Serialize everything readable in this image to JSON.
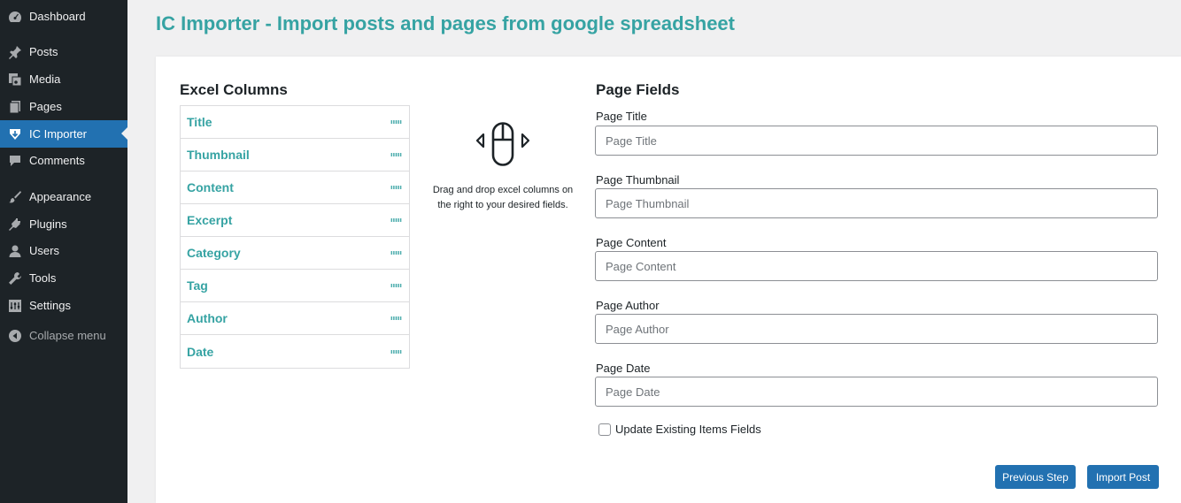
{
  "sidebar": {
    "items": [
      {
        "label": "Dashboard",
        "icon": "dashboard-icon"
      },
      {
        "label": "Posts",
        "icon": "pin-icon"
      },
      {
        "label": "Media",
        "icon": "media-icon"
      },
      {
        "label": "Pages",
        "icon": "pages-icon"
      },
      {
        "label": "IC Importer",
        "icon": "importer-icon",
        "active": true
      },
      {
        "label": "Comments",
        "icon": "comment-icon"
      },
      {
        "label": "Appearance",
        "icon": "brush-icon"
      },
      {
        "label": "Plugins",
        "icon": "plugin-icon"
      },
      {
        "label": "Users",
        "icon": "user-icon"
      },
      {
        "label": "Tools",
        "icon": "wrench-icon"
      },
      {
        "label": "Settings",
        "icon": "settings-icon"
      }
    ],
    "collapse_label": "Collapse menu"
  },
  "page": {
    "title": "IC Importer - Import posts and pages from google spreadsheet"
  },
  "excel": {
    "heading": "Excel Columns",
    "columns": [
      "Title",
      "Thumbnail",
      "Content",
      "Excerpt",
      "Category",
      "Tag",
      "Author",
      "Date"
    ]
  },
  "hint": {
    "text": "Drag and drop excel columns on the right to your desired fields.",
    "icon": "mouse-drag-icon"
  },
  "fields": {
    "heading": "Page Fields",
    "items": [
      {
        "label": "Page Title",
        "placeholder": "Page Title",
        "value": ""
      },
      {
        "label": "Page Thumbnail",
        "placeholder": "Page Thumbnail",
        "value": ""
      },
      {
        "label": "Page Content",
        "placeholder": "Page Content",
        "value": ""
      },
      {
        "label": "Page Author",
        "placeholder": "Page Author",
        "value": ""
      },
      {
        "label": "Page Date",
        "placeholder": "Page Date",
        "value": ""
      }
    ],
    "update_label": "Update Existing Items Fields",
    "update_checked": false
  },
  "actions": {
    "previous_label": "Previous Step",
    "import_label": "Import Post"
  },
  "colors": {
    "sidebar_bg": "#1d2327",
    "active_bg": "#2271b1",
    "accent": "#36a3a3",
    "button": "#2271b1"
  }
}
